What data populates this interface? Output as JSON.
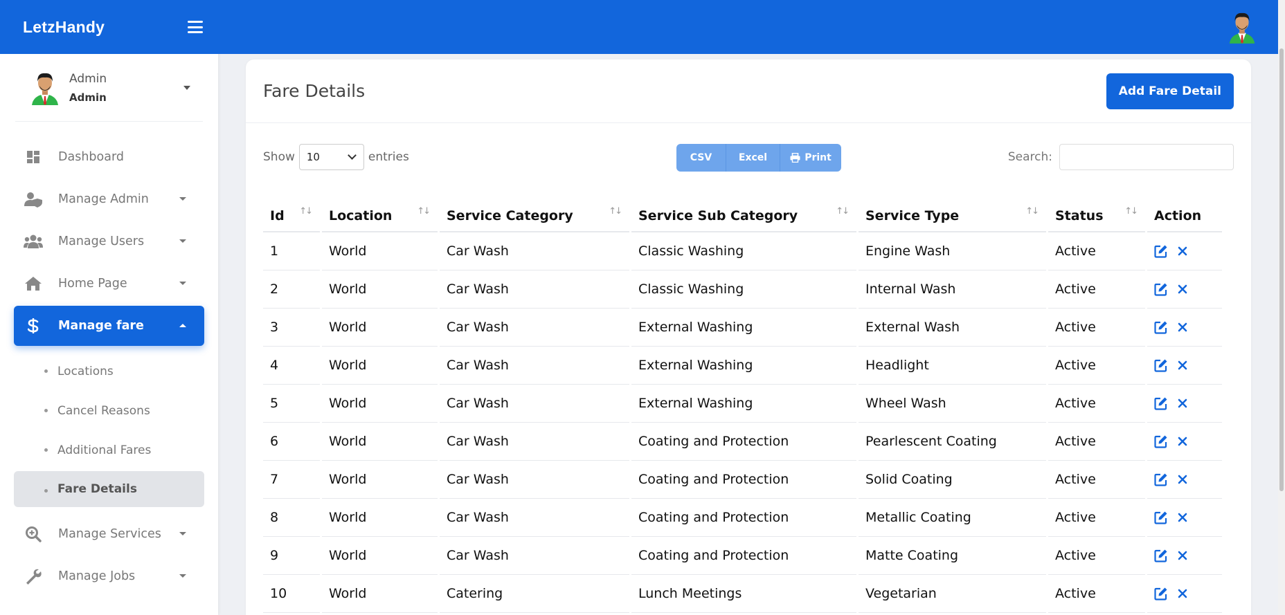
{
  "brand": {
    "name": "LetzHandy"
  },
  "user": {
    "name": "Admin",
    "role": "Admin"
  },
  "sidebar": {
    "items": [
      {
        "label": "Dashboard",
        "icon": "dashboard-icon"
      },
      {
        "label": "Manage Admin",
        "icon": "user-shield-icon"
      },
      {
        "label": "Manage Users",
        "icon": "users-icon"
      },
      {
        "label": "Home Page",
        "icon": "home-icon"
      },
      {
        "label": "Manage fare",
        "icon": "dollar-icon",
        "active": true
      },
      {
        "label": "Manage Services",
        "icon": "search-plus-icon"
      },
      {
        "label": "Manage Jobs",
        "icon": "wrench-icon"
      }
    ],
    "subitems": [
      {
        "label": "Locations"
      },
      {
        "label": "Cancel Reasons"
      },
      {
        "label": "Additional Fares"
      },
      {
        "label": "Fare Details",
        "active": true
      }
    ]
  },
  "page": {
    "title": "Fare Details",
    "add_button": "Add Fare Detail"
  },
  "controls": {
    "show_label": "Show",
    "entries_value": "10",
    "entries_label": "entries",
    "export": {
      "csv": "CSV",
      "excel": "Excel",
      "print": "Print"
    },
    "search_label": "Search:",
    "search_value": ""
  },
  "table": {
    "columns": [
      "Id",
      "Location",
      "Service Category",
      "Service Sub Category",
      "Service Type",
      "Status",
      "Action"
    ],
    "rows": [
      [
        "1",
        "World",
        "Car Wash",
        "Classic Washing",
        "Engine Wash",
        "Active"
      ],
      [
        "2",
        "World",
        "Car Wash",
        "Classic Washing",
        "Internal Wash",
        "Active"
      ],
      [
        "3",
        "World",
        "Car Wash",
        "External Washing",
        "External Wash",
        "Active"
      ],
      [
        "4",
        "World",
        "Car Wash",
        "External Washing",
        "Headlight",
        "Active"
      ],
      [
        "5",
        "World",
        "Car Wash",
        "External Washing",
        "Wheel Wash",
        "Active"
      ],
      [
        "6",
        "World",
        "Car Wash",
        "Coating and Protection",
        "Pearlescent Coating",
        "Active"
      ],
      [
        "7",
        "World",
        "Car Wash",
        "Coating and Protection",
        "Solid Coating",
        "Active"
      ],
      [
        "8",
        "World",
        "Car Wash",
        "Coating and Protection",
        "Metallic Coating",
        "Active"
      ],
      [
        "9",
        "World",
        "Car Wash",
        "Coating and Protection",
        "Matte Coating",
        "Active"
      ],
      [
        "10",
        "World",
        "Catering",
        "Lunch Meetings",
        "Vegetarian",
        "Active"
      ]
    ]
  },
  "colors": {
    "primary": "#1266dc",
    "export_button": "#6ea5ec",
    "background": "#eef0f4"
  }
}
